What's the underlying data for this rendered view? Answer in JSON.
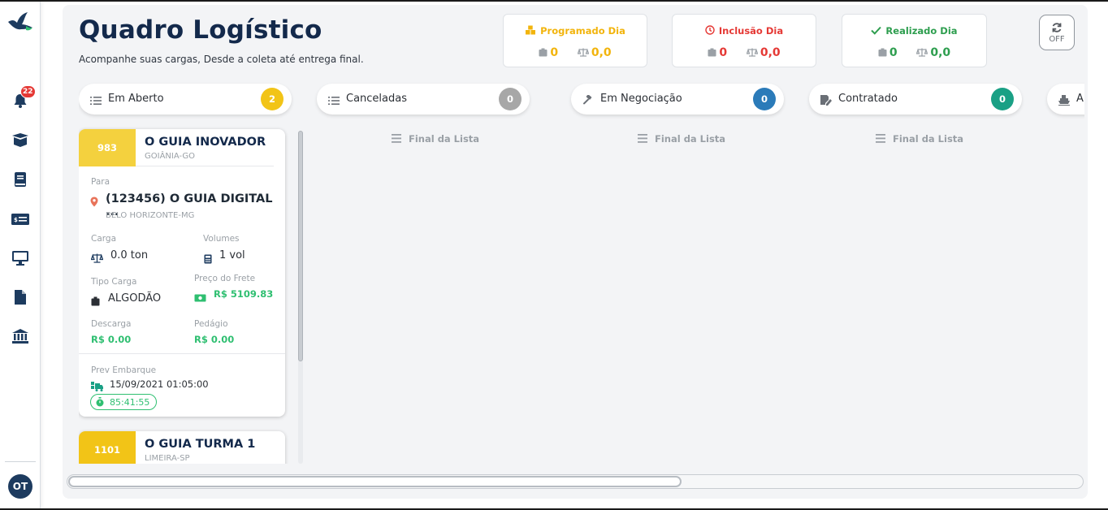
{
  "header": {
    "title": "Quadro Logístico",
    "subtitle": "Acompanhe suas cargas, Desde a coleta até entrega final."
  },
  "sidebar": {
    "notifications_badge": "22",
    "avatar_initials": "OT"
  },
  "kpis": [
    {
      "label": "Programado Dia",
      "count": "0",
      "weight": "0,0",
      "color": "#f2b40c",
      "icon": "boxes-icon"
    },
    {
      "label": "Inclusão Dia",
      "count": "0",
      "weight": "0,0",
      "color": "#e53935",
      "icon": "clock-icon"
    },
    {
      "label": "Realizado Dia",
      "count": "0",
      "weight": "0,0",
      "color": "#2e9e4f",
      "icon": "check-icon"
    }
  ],
  "sync": {
    "label": "OFF"
  },
  "columns": [
    {
      "label": "Em Aberto",
      "count": "2",
      "count_color": "#f2c417",
      "icon": "list-icon"
    },
    {
      "label": "Canceladas",
      "count": "0",
      "count_color": "#a7a7a7",
      "icon": "list-icon"
    },
    {
      "label": "Em Negociação",
      "count": "0",
      "count_color": "#2b7bb9",
      "icon": "gavel-icon"
    },
    {
      "label": "Contratado",
      "count": "0",
      "count_color": "#1aa085",
      "icon": "signature-icon"
    },
    {
      "label": "A",
      "icon": "ship-icon"
    }
  ],
  "end_of_list": "Final da Lista",
  "cards": [
    {
      "id": "983",
      "shipper": "O GUIA INOVADOR",
      "shipper_city": "GOIÂNIA-GO",
      "to_label": "Para",
      "recipient": "(123456) O GUIA DIGITAL ...",
      "recipient_city": "BELO HORIZONTE-MG",
      "carga_label": "Carga",
      "carga_value": "0.0 ton",
      "volumes_label": "Volumes",
      "volumes_value": "1 vol",
      "tipo_label": "Tipo Carga",
      "tipo_value": "ALGODÃO",
      "frete_label": "Preço do Frete",
      "frete_value": "R$ 5109.83",
      "descarga_label": "Descarga",
      "descarga_value": "R$ 0.00",
      "pedagio_label": "Pedágio",
      "pedagio_value": "R$ 0.00",
      "embarque_label": "Prev Embarque",
      "embarque_value": "15/09/2021 01:05:00",
      "timer": "85:41:55"
    },
    {
      "id": "1101",
      "shipper": "O GUIA TURMA 1",
      "shipper_city": "LIMEIRA-SP"
    }
  ]
}
